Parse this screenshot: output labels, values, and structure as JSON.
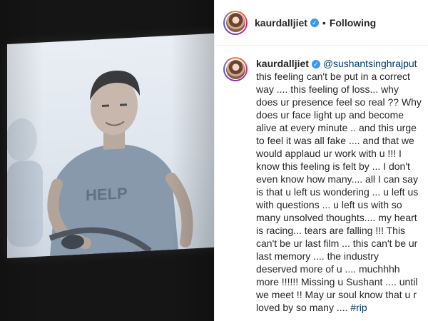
{
  "post": {
    "username": "kaurdalljiet",
    "follow_status": "Following",
    "separator": "•"
  },
  "caption": {
    "username": "kaurdalljiet",
    "mention": "@sushantsinghrajput",
    "text": "this feeling can't be put in a correct way .... this feeling of loss... why does ur presence feel so real ?? Why does ur face light up and become alive at every minute .. and this urge to feel it was all fake .... and that we would applaud ur work with u !!! I know this feeling is felt by ... I don't even know how many.... all I can say is that u left us wondering ... u left us with questions ... u left us with so many unsolved thoughts.... my heart is racing... tears are falling !!! This can't be ur last film ... this can't be ur last memory .... the industry deserved more of u .... muchhhh more !!!!!! Missing u Sushant .... until we meet !! May ur soul know that u r loved by so many ....",
    "hashtag": "#rip"
  },
  "media": {
    "shirt_text": "HELP"
  },
  "icons": {
    "verified": "verified-badge-icon",
    "avatar": "profile-avatar"
  },
  "colors": {
    "verified": "#3897f0",
    "link": "#00376b",
    "media_bg": "#151515"
  }
}
